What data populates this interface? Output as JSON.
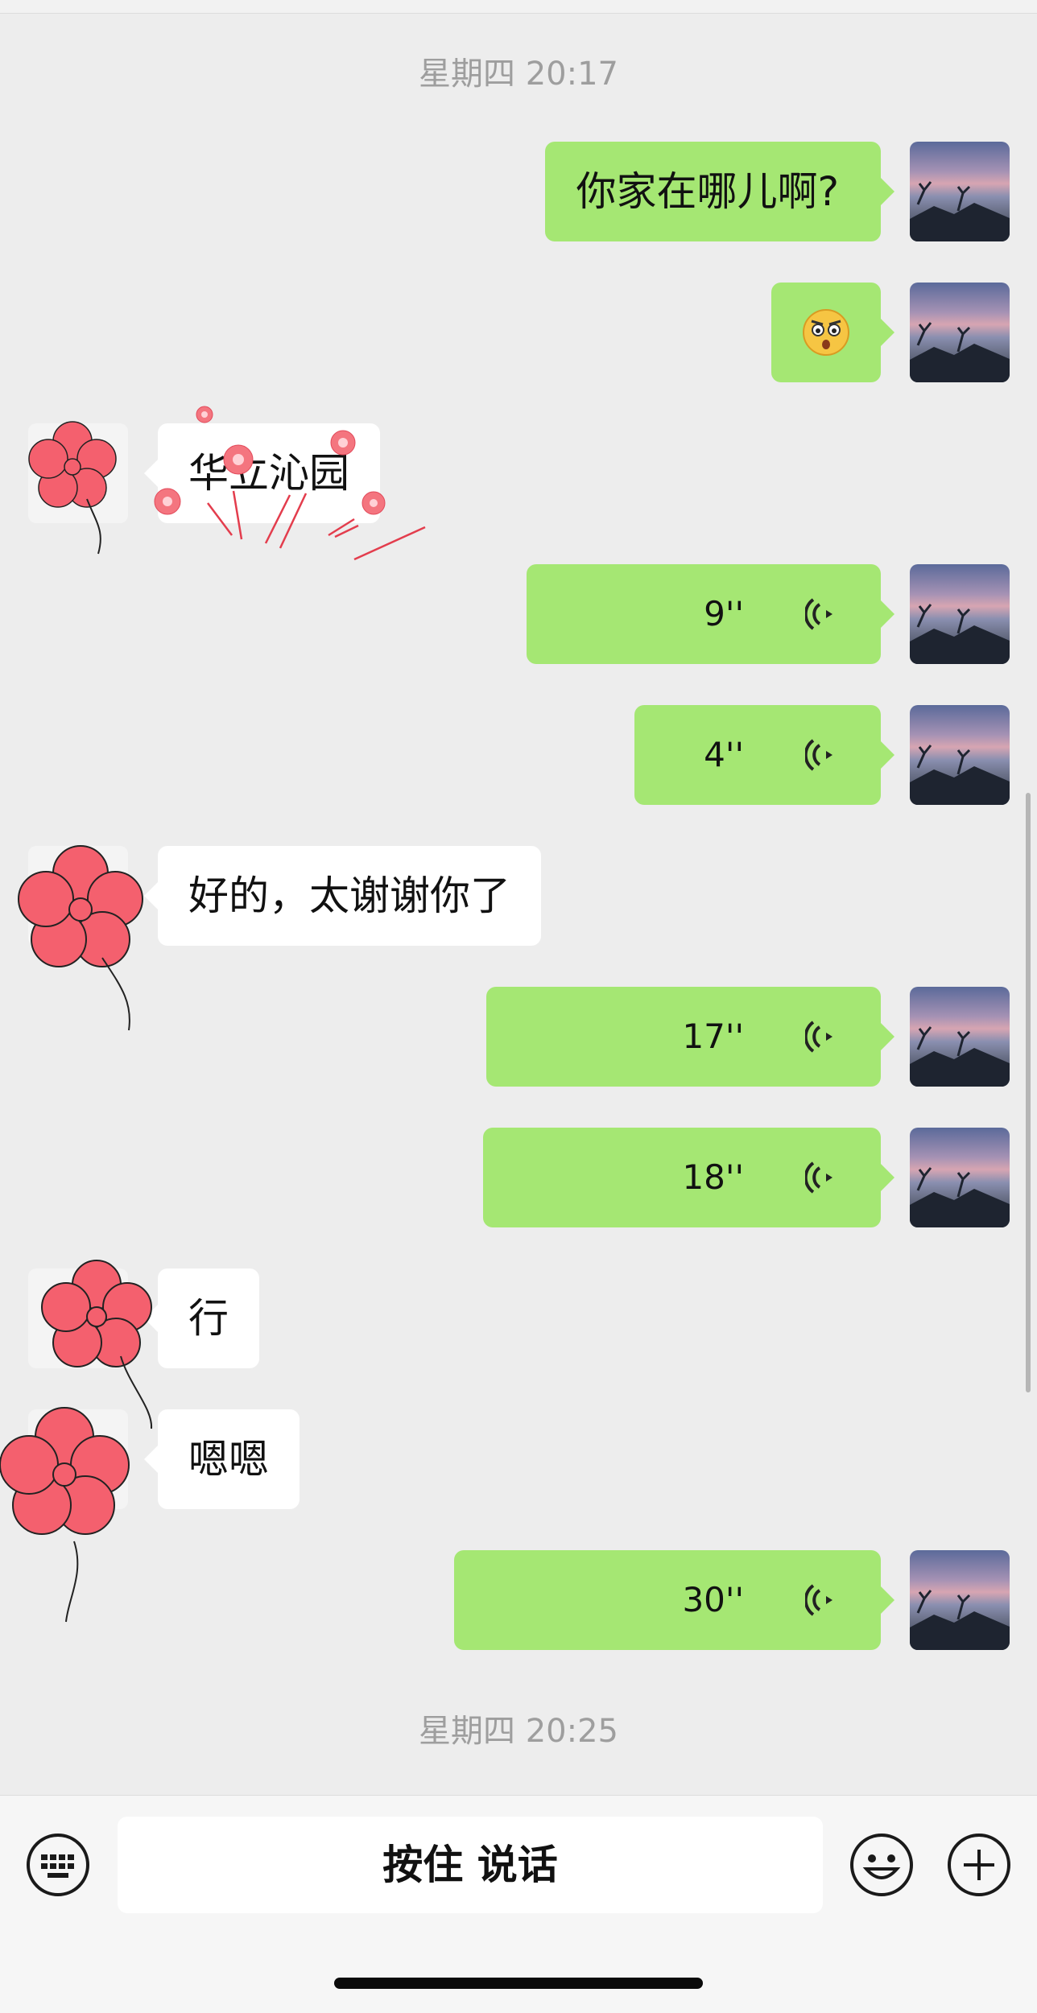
{
  "timestamps": {
    "first": "星期四 20:17",
    "last": "星期四 20:25"
  },
  "messages": [
    {
      "side": "me",
      "type": "text",
      "text": "你家在哪儿啊?"
    },
    {
      "side": "me",
      "type": "emoji",
      "emoji": "surprised-angry-face-emoji"
    },
    {
      "side": "them",
      "type": "text",
      "text": "华立沁园"
    },
    {
      "side": "me",
      "type": "voice",
      "duration": "9''"
    },
    {
      "side": "me",
      "type": "voice",
      "duration": "4''"
    },
    {
      "side": "them",
      "type": "text",
      "text": "好的，太谢谢你了"
    },
    {
      "side": "me",
      "type": "voice",
      "duration": "17''"
    },
    {
      "side": "me",
      "type": "voice",
      "duration": "18''"
    },
    {
      "side": "them",
      "type": "text",
      "text": "行"
    },
    {
      "side": "them",
      "type": "text",
      "text": "嗯嗯"
    },
    {
      "side": "me",
      "type": "voice",
      "duration": "30''"
    }
  ],
  "input_bar": {
    "hold_to_talk_label": "按住 说话",
    "keyboard_icon": "keyboard-icon",
    "emoji_icon": "smiley-icon",
    "more_icon": "plus-circle-icon"
  },
  "colors": {
    "background": "#ededed",
    "my_bubble": "#a5e773",
    "their_bubble": "#ffffff",
    "sticker_flower": "#f4606e"
  }
}
